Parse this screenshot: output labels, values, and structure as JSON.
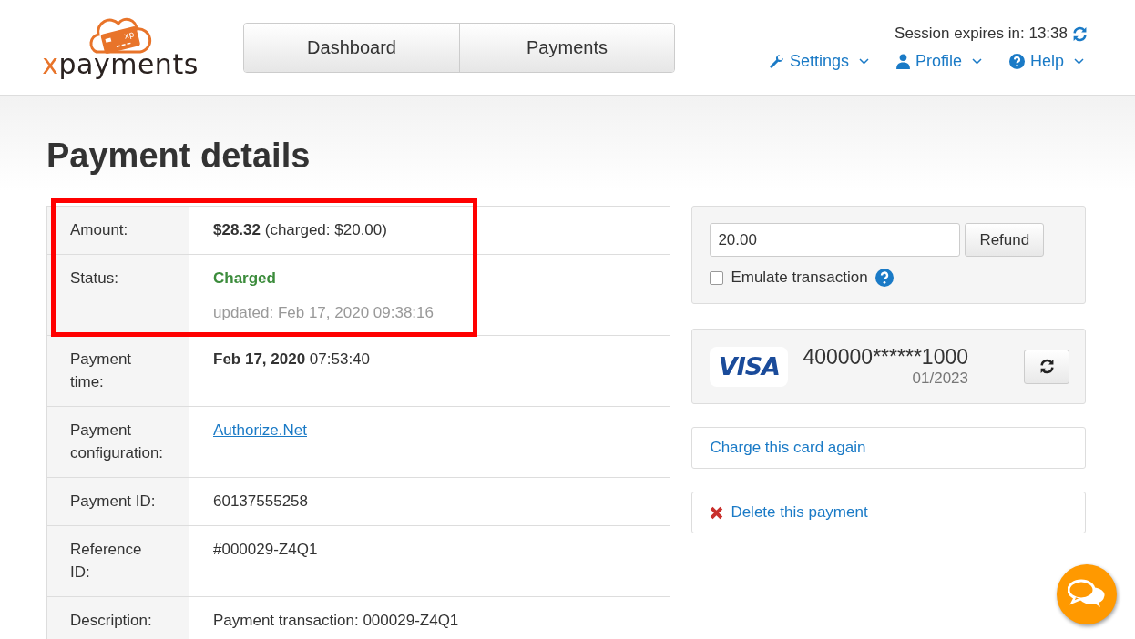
{
  "logo": {
    "badge": "xp",
    "mark": "x",
    "word": "payments"
  },
  "nav_tabs": [
    {
      "label": "Dashboard",
      "selected": false
    },
    {
      "label": "Payments",
      "selected": false
    }
  ],
  "session": {
    "label": "Session expires in: 13:38"
  },
  "menus": [
    {
      "label": "Settings"
    },
    {
      "label": "Profile"
    },
    {
      "label": "Help"
    }
  ],
  "page_title": "Payment details",
  "details": [
    {
      "label": "Amount:",
      "kind": "text",
      "value": "**$28.32** (charged: $20.00)",
      "highlighted": true
    },
    {
      "label": "Status:",
      "kind": "status",
      "value": "Charged",
      "note": "updated: Feb 17, 2020 09:38:16",
      "highlighted": true
    },
    {
      "label": "Payment time:",
      "kind": "text",
      "value": "**Feb 17, 2020** 07:53:40",
      "highlighted": false
    },
    {
      "label": "Payment configuration:",
      "kind": "link",
      "value": "Authorize.Net",
      "highlighted": false
    },
    {
      "label": "Payment ID:",
      "kind": "text",
      "value": "60137555258",
      "highlighted": false
    },
    {
      "label": "Reference ID:",
      "kind": "text",
      "value": "#000029-Z4Q1",
      "highlighted": false
    },
    {
      "label": "Description:",
      "kind": "text",
      "value": "Payment transaction: 000029-Z4Q1",
      "highlighted": false
    }
  ],
  "refund": {
    "amount": "20.00",
    "button": "Refund",
    "emulate_label": "Emulate transaction",
    "emulate_checked": false
  },
  "card": {
    "brand": "VISA",
    "number": "400000******1000",
    "expiry": "01/2023"
  },
  "actions": [
    {
      "label": "Charge this card again",
      "kind": "plain"
    },
    {
      "label": "Delete this payment",
      "kind": "delete"
    }
  ]
}
